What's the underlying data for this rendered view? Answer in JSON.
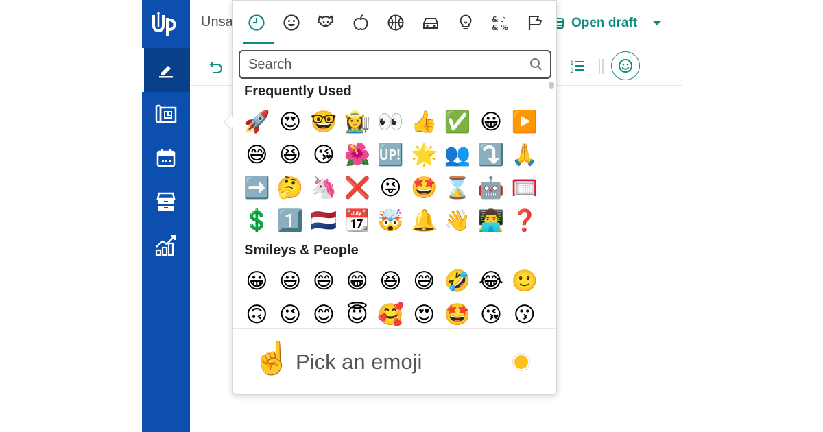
{
  "app": {
    "logo_text": "Up"
  },
  "sidebar": {
    "items": [
      {
        "icon": "pencil-icon"
      },
      {
        "icon": "blueprint-icon"
      },
      {
        "icon": "calendar-icon"
      },
      {
        "icon": "archive-icon"
      },
      {
        "icon": "chart-icon"
      }
    ],
    "bg": "#0d4fae"
  },
  "header": {
    "title": "Unsa",
    "open_draft_label": "Open draft"
  },
  "toolbar": {
    "undo_icon": "undo-icon",
    "list_icon": "ordered-list-icon",
    "emoji_icon": "smiley-icon"
  },
  "picker": {
    "categories": [
      "recent-icon",
      "smiley-icon",
      "dog-icon",
      "apple-icon",
      "basketball-icon",
      "car-icon",
      "lightbulb-icon",
      "symbols-icon",
      "flags-icon"
    ],
    "search_placeholder": "Search",
    "sections": [
      {
        "title": "Frequently Used",
        "rows": [
          [
            "🚀",
            "😍",
            "🤓",
            "👩‍🌾",
            "👀",
            "👍",
            "✅",
            "😀",
            "▶️"
          ],
          [
            "😅",
            "😆",
            "😘",
            "🌺",
            "🆙",
            "🌟",
            "👥",
            "⤵️",
            "🙏"
          ],
          [
            "➡️",
            "🤔",
            "🦄",
            "❌",
            "😜",
            "🤩",
            "⌛",
            "🤖",
            "🥅"
          ],
          [
            "💲",
            "1️⃣",
            "🇳🇱",
            "📆",
            "🤯",
            "🔔",
            "👋",
            "👨‍💻",
            "❓"
          ]
        ]
      },
      {
        "title": "Smileys & People",
        "rows": [
          [
            "😀",
            "😃",
            "😄",
            "😁",
            "😆",
            "😅",
            "🤣",
            "😂",
            "🙂"
          ],
          [
            "🙃",
            "😉",
            "😊",
            "😇",
            "🥰",
            "😍",
            "🤩",
            "😘",
            "😗"
          ]
        ]
      }
    ],
    "preview": {
      "emoji": "☝️",
      "text": "Pick an emoji"
    },
    "skin_tone_color": "#fcc21b",
    "accent": "#118a7e"
  }
}
